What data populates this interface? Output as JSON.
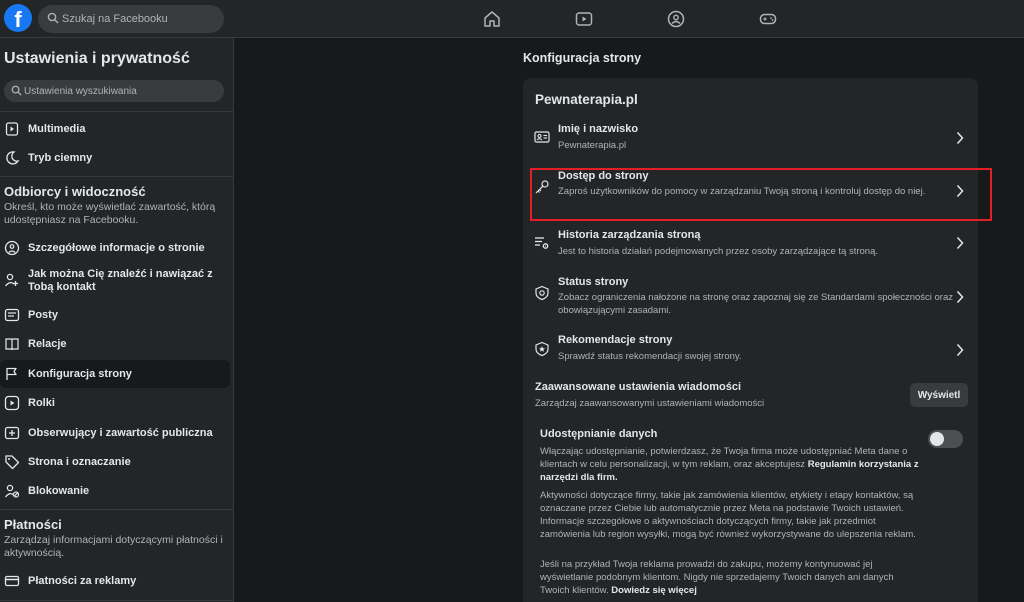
{
  "header": {
    "logo_letter": "f",
    "search_placeholder": "Szukaj na Facebooku"
  },
  "sidebar": {
    "title": "Ustawienia i prywatność",
    "search_placeholder": "Ustawienia wyszukiwania",
    "items_top": [
      {
        "label": "Multimedia",
        "icon": "media-icon"
      },
      {
        "label": "Tryb ciemny",
        "icon": "moon-icon"
      }
    ],
    "audience": {
      "heading": "Odbiorcy i widoczność",
      "desc": "Określ, kto może wyświetlać zawartość, którą udostępniasz na Facebooku."
    },
    "items_audience": [
      {
        "label": "Szczegółowe informacje o stronie",
        "icon": "info-icon"
      },
      {
        "label": "Jak można Cię znaleźć i nawiązać z Tobą kontakt",
        "icon": "person-search-icon"
      },
      {
        "label": "Posty",
        "icon": "posts-icon"
      },
      {
        "label": "Relacje",
        "icon": "book-icon"
      },
      {
        "label": "Konfiguracja strony",
        "icon": "flag-icon",
        "active": true
      },
      {
        "label": "Rolki",
        "icon": "reels-icon"
      },
      {
        "label": "Obserwujący i zawartość publiczna",
        "icon": "plus-box-icon"
      },
      {
        "label": "Strona i oznaczanie",
        "icon": "tag-icon"
      },
      {
        "label": "Blokowanie",
        "icon": "block-user-icon"
      }
    ],
    "payments": {
      "heading": "Płatności",
      "desc": "Zarządzaj informacjami dotyczącymi płatności i aktywnością."
    },
    "items_payments": [
      {
        "label": "Płatności za reklamy",
        "icon": "card-icon"
      }
    ]
  },
  "main": {
    "title": "Konfiguracja strony",
    "card_title": "Pewnaterapia.pl",
    "rows": [
      {
        "title": "Imię i nazwisko",
        "desc": "Pewnaterapia.pl",
        "icon": "id-card-icon"
      },
      {
        "title": "Dostęp do strony",
        "desc": "Zaproś użytkowników do pomocy w zarządzaniu Twoją stroną i kontroluj dostęp do niej.",
        "icon": "key-icon"
      },
      {
        "title": "Historia zarządzania stroną",
        "desc": "Jest to historia działań podejmowanych przez osoby zarządzające tą stroną.",
        "icon": "history-gear-icon"
      },
      {
        "title": "Status strony",
        "desc": "Zobacz ograniczenia nałożone na stronę oraz zapoznaj się ze Standardami społeczności oraz obowiązującymi zasadami.",
        "icon": "shield-icon"
      },
      {
        "title": "Rekomendacje strony",
        "desc": "Sprawdź status rekomendacji swojej strony.",
        "icon": "star-shield-icon"
      }
    ],
    "advanced": {
      "title": "Zaawansowane ustawienia wiadomości",
      "desc": "Zarządzaj zaawansowanymi ustawieniami wiadomości",
      "button": "Wyświetl"
    },
    "sharing": {
      "title": "Udostępnianie danych",
      "toggle_on": false,
      "p1_text": "Włączając udostępnianie, potwierdzasz, że Twoja firma może udostępniać Meta dane o klientach w celu personalizacji, w tym reklam, oraz akceptujesz ",
      "p1_link": "Regulamin korzystania z narzędzi dla firm.",
      "p2": "Aktywności dotyczące firmy, takie jak zamówienia klientów, etykiety i etapy kontaktów, są oznaczane przez Ciebie lub automatycznie przez Meta na podstawie Twoich ustawień. Informacje szczegółowe o aktywnościach dotyczących firmy, takie jak przedmiot zamówienia lub region wysyłki, mogą być również wykorzystywane do ulepszenia reklam.",
      "p3_text": "Jeśli na przykład Twoja reklama prowadzi do zakupu, możemy kontynuować jej wyświetlanie podobnym klientom. Nigdy nie sprzedajemy Twoich danych ani danych Twoich klientów. ",
      "p3_link": "Dowiedz się więcej"
    }
  },
  "colors": {
    "accent": "#1877f2",
    "highlight": "#e41e26",
    "background": "#18191a",
    "surface": "#242526"
  }
}
